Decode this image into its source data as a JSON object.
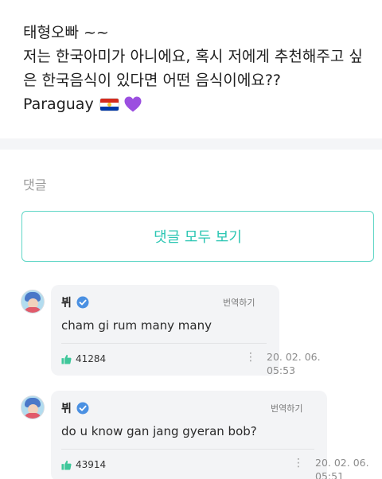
{
  "post": {
    "line1": "태형오빠 ~~",
    "line2": "저는 한국아미가 아니에요, 혹시 저에게 추천해주고 싶",
    "line3": "은 한국음식이 있다면 어떤 음식이에요??",
    "line4": "Paraguay",
    "flag_icon": "paraguay-flag-icon",
    "heart_icon": "purple-heart-icon",
    "heart_color": "#9b4fe0"
  },
  "comments_section": {
    "label": "댓글",
    "view_all_label": "댓글 모두 보기",
    "accent_color": "#2cc6b3"
  },
  "comments": [
    {
      "author": "뷔",
      "translate_label": "번역하기",
      "text": "cham gi rum many many",
      "likes": "41284",
      "date_line1": "20. 02. 06.",
      "date_line2": "05:53"
    },
    {
      "author": "뷔",
      "translate_label": "번역하기",
      "text": "do u know gan jang gyeran bob?",
      "likes": "43914",
      "date_line1": "20. 02. 06.",
      "date_line2": "05:51"
    }
  ]
}
